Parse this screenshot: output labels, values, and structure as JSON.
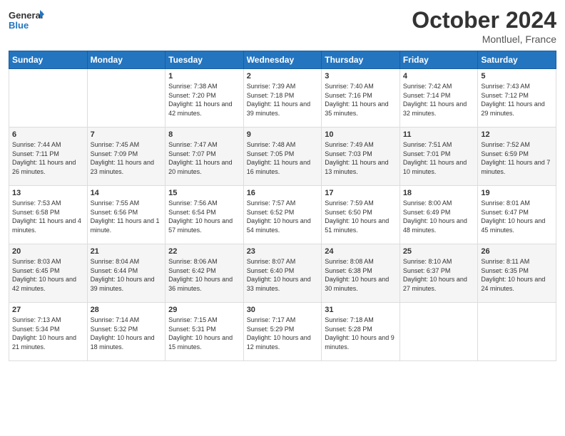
{
  "header": {
    "logo_text_general": "General",
    "logo_text_blue": "Blue",
    "month_title": "October 2024",
    "location": "Montluel, France"
  },
  "weekdays": [
    "Sunday",
    "Monday",
    "Tuesday",
    "Wednesday",
    "Thursday",
    "Friday",
    "Saturday"
  ],
  "weeks": [
    [
      {
        "day": "",
        "sunrise": "",
        "sunset": "",
        "daylight": ""
      },
      {
        "day": "",
        "sunrise": "",
        "sunset": "",
        "daylight": ""
      },
      {
        "day": "1",
        "sunrise": "Sunrise: 7:38 AM",
        "sunset": "Sunset: 7:20 PM",
        "daylight": "Daylight: 11 hours and 42 minutes."
      },
      {
        "day": "2",
        "sunrise": "Sunrise: 7:39 AM",
        "sunset": "Sunset: 7:18 PM",
        "daylight": "Daylight: 11 hours and 39 minutes."
      },
      {
        "day": "3",
        "sunrise": "Sunrise: 7:40 AM",
        "sunset": "Sunset: 7:16 PM",
        "daylight": "Daylight: 11 hours and 35 minutes."
      },
      {
        "day": "4",
        "sunrise": "Sunrise: 7:42 AM",
        "sunset": "Sunset: 7:14 PM",
        "daylight": "Daylight: 11 hours and 32 minutes."
      },
      {
        "day": "5",
        "sunrise": "Sunrise: 7:43 AM",
        "sunset": "Sunset: 7:12 PM",
        "daylight": "Daylight: 11 hours and 29 minutes."
      }
    ],
    [
      {
        "day": "6",
        "sunrise": "Sunrise: 7:44 AM",
        "sunset": "Sunset: 7:11 PM",
        "daylight": "Daylight: 11 hours and 26 minutes."
      },
      {
        "day": "7",
        "sunrise": "Sunrise: 7:45 AM",
        "sunset": "Sunset: 7:09 PM",
        "daylight": "Daylight: 11 hours and 23 minutes."
      },
      {
        "day": "8",
        "sunrise": "Sunrise: 7:47 AM",
        "sunset": "Sunset: 7:07 PM",
        "daylight": "Daylight: 11 hours and 20 minutes."
      },
      {
        "day": "9",
        "sunrise": "Sunrise: 7:48 AM",
        "sunset": "Sunset: 7:05 PM",
        "daylight": "Daylight: 11 hours and 16 minutes."
      },
      {
        "day": "10",
        "sunrise": "Sunrise: 7:49 AM",
        "sunset": "Sunset: 7:03 PM",
        "daylight": "Daylight: 11 hours and 13 minutes."
      },
      {
        "day": "11",
        "sunrise": "Sunrise: 7:51 AM",
        "sunset": "Sunset: 7:01 PM",
        "daylight": "Daylight: 11 hours and 10 minutes."
      },
      {
        "day": "12",
        "sunrise": "Sunrise: 7:52 AM",
        "sunset": "Sunset: 6:59 PM",
        "daylight": "Daylight: 11 hours and 7 minutes."
      }
    ],
    [
      {
        "day": "13",
        "sunrise": "Sunrise: 7:53 AM",
        "sunset": "Sunset: 6:58 PM",
        "daylight": "Daylight: 11 hours and 4 minutes."
      },
      {
        "day": "14",
        "sunrise": "Sunrise: 7:55 AM",
        "sunset": "Sunset: 6:56 PM",
        "daylight": "Daylight: 11 hours and 1 minute."
      },
      {
        "day": "15",
        "sunrise": "Sunrise: 7:56 AM",
        "sunset": "Sunset: 6:54 PM",
        "daylight": "Daylight: 10 hours and 57 minutes."
      },
      {
        "day": "16",
        "sunrise": "Sunrise: 7:57 AM",
        "sunset": "Sunset: 6:52 PM",
        "daylight": "Daylight: 10 hours and 54 minutes."
      },
      {
        "day": "17",
        "sunrise": "Sunrise: 7:59 AM",
        "sunset": "Sunset: 6:50 PM",
        "daylight": "Daylight: 10 hours and 51 minutes."
      },
      {
        "day": "18",
        "sunrise": "Sunrise: 8:00 AM",
        "sunset": "Sunset: 6:49 PM",
        "daylight": "Daylight: 10 hours and 48 minutes."
      },
      {
        "day": "19",
        "sunrise": "Sunrise: 8:01 AM",
        "sunset": "Sunset: 6:47 PM",
        "daylight": "Daylight: 10 hours and 45 minutes."
      }
    ],
    [
      {
        "day": "20",
        "sunrise": "Sunrise: 8:03 AM",
        "sunset": "Sunset: 6:45 PM",
        "daylight": "Daylight: 10 hours and 42 minutes."
      },
      {
        "day": "21",
        "sunrise": "Sunrise: 8:04 AM",
        "sunset": "Sunset: 6:44 PM",
        "daylight": "Daylight: 10 hours and 39 minutes."
      },
      {
        "day": "22",
        "sunrise": "Sunrise: 8:06 AM",
        "sunset": "Sunset: 6:42 PM",
        "daylight": "Daylight: 10 hours and 36 minutes."
      },
      {
        "day": "23",
        "sunrise": "Sunrise: 8:07 AM",
        "sunset": "Sunset: 6:40 PM",
        "daylight": "Daylight: 10 hours and 33 minutes."
      },
      {
        "day": "24",
        "sunrise": "Sunrise: 8:08 AM",
        "sunset": "Sunset: 6:38 PM",
        "daylight": "Daylight: 10 hours and 30 minutes."
      },
      {
        "day": "25",
        "sunrise": "Sunrise: 8:10 AM",
        "sunset": "Sunset: 6:37 PM",
        "daylight": "Daylight: 10 hours and 27 minutes."
      },
      {
        "day": "26",
        "sunrise": "Sunrise: 8:11 AM",
        "sunset": "Sunset: 6:35 PM",
        "daylight": "Daylight: 10 hours and 24 minutes."
      }
    ],
    [
      {
        "day": "27",
        "sunrise": "Sunrise: 7:13 AM",
        "sunset": "Sunset: 5:34 PM",
        "daylight": "Daylight: 10 hours and 21 minutes."
      },
      {
        "day": "28",
        "sunrise": "Sunrise: 7:14 AM",
        "sunset": "Sunset: 5:32 PM",
        "daylight": "Daylight: 10 hours and 18 minutes."
      },
      {
        "day": "29",
        "sunrise": "Sunrise: 7:15 AM",
        "sunset": "Sunset: 5:31 PM",
        "daylight": "Daylight: 10 hours and 15 minutes."
      },
      {
        "day": "30",
        "sunrise": "Sunrise: 7:17 AM",
        "sunset": "Sunset: 5:29 PM",
        "daylight": "Daylight: 10 hours and 12 minutes."
      },
      {
        "day": "31",
        "sunrise": "Sunrise: 7:18 AM",
        "sunset": "Sunset: 5:28 PM",
        "daylight": "Daylight: 10 hours and 9 minutes."
      },
      {
        "day": "",
        "sunrise": "",
        "sunset": "",
        "daylight": ""
      },
      {
        "day": "",
        "sunrise": "",
        "sunset": "",
        "daylight": ""
      }
    ]
  ]
}
